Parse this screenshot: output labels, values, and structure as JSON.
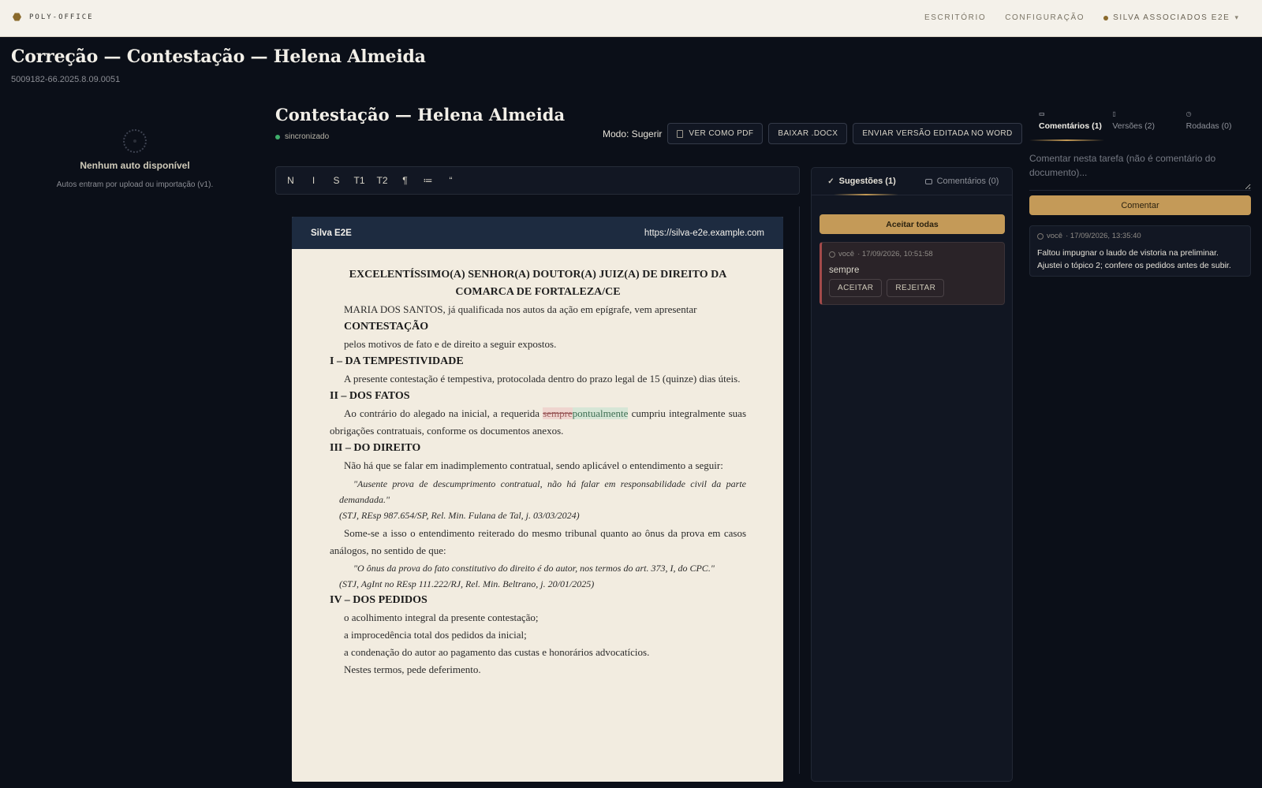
{
  "topbar": {
    "brand": "POLY-OFFICE",
    "nav": [
      "ESCRITÓRIO",
      "CONFIGURAÇÃO"
    ],
    "org": "SILVA ASSOCIADOS E2E",
    "org_chevron": "▾"
  },
  "page": {
    "title": "Correção — Contestação — Helena Almeida",
    "case_number": "5009182-66.2025.8.09.0051"
  },
  "autos": {
    "empty_title": "Nenhum auto disponível",
    "empty_sub": "Autos entram por upload ou importação (v1)."
  },
  "document": {
    "title": "Contestação — Helena Almeida",
    "sync_status": "sincronizado",
    "mode": "Modo: Sugerir",
    "buttons": {
      "pdf": "VER COMO PDF",
      "docx": "BAIXAR .DOCX",
      "word": "ENVIAR VERSÃO EDITADA NO WORD"
    },
    "toolbar": [
      "N",
      "I",
      "S",
      "T1",
      "T2",
      "¶",
      "≔",
      "“"
    ]
  },
  "paper": {
    "firm": "Silva E2E",
    "url": "https://silva-e2e.example.com",
    "address_line1": "EXCELENTÍSSIMO(A) SENHOR(A) DOUTOR(A) JUIZ(A) DE DIREITO DA",
    "address_line2": "COMARCA DE FORTALEZA/CE",
    "intro": "MARIA DOS SANTOS, já qualificada nos autos da ação em epígrafe, vem apresentar",
    "intro_title": "CONTESTAÇÃO",
    "intro_end": "pelos motivos de fato e de direito a seguir expostos.",
    "h1": "I – DA TEMPESTIVIDADE",
    "p1": "A presente contestação é tempestiva, protocolada dentro do prazo legal de 15 (quinze) dias úteis.",
    "h2": "II – DOS FATOS",
    "p2_before": "Ao contrário do alegado na inicial, a requerida ",
    "p2_deleted": "sempre",
    "p2_inserted": "pontualmente",
    "p2_after": " cumpriu integralmente suas obrigações contratuais, conforme os documentos anexos.",
    "h3": "III – DO DIREITO",
    "p3": "Não há que se falar em inadimplemento contratual, sendo aplicável o entendimento a seguir:",
    "q1": "\"Ausente prova de descumprimento contratual, não há falar em responsabilidade civil da parte demandada.\"",
    "q1_cite": "(STJ, REsp 987.654/SP, Rel. Min. Fulana de Tal, j. 03/03/2024)",
    "p4": "Some-se a isso o entendimento reiterado do mesmo tribunal quanto ao ônus da prova em casos análogos, no sentido de que:",
    "q2": "\"O ônus da prova do fato constitutivo do direito é do autor, nos termos do art. 373, I, do CPC.\"",
    "q2_cite": "(STJ, AgInt no REsp 111.222/RJ, Rel. Min. Beltrano, j. 20/01/2025)",
    "h4": "IV – DOS PEDIDOS",
    "req1": "o acolhimento integral da presente contestação;",
    "req2": "a improcedência total dos pedidos da inicial;",
    "req3": "a condenação do autor ao pagamento das custas e honorários advocatícios.",
    "closing": "Nestes termos, pede deferimento."
  },
  "suggestions": {
    "tab_suggestions": "Sugestões (1)",
    "tab_comments": "Comentários (0)",
    "accept_all": "Aceitar todas",
    "items": [
      {
        "author": "você",
        "timestamp": "· 17/09/2026, 10:51:58",
        "text": "sempre",
        "accept": "ACEITAR",
        "reject": "REJEITAR"
      }
    ]
  },
  "task_panel": {
    "tabs": [
      "Comentários (1)",
      "Versões (2)",
      "Rodadas (0)"
    ],
    "placeholder": "Comentar nesta tarefa (não é comentário do documento)...",
    "comment_button": "Comentar",
    "comments": [
      {
        "author": "você",
        "timestamp": "· 17/09/2026, 13:35:40",
        "text": "Faltou impugnar o laudo de vistoria na preliminar. Ajustei o tópico 2; confere os pedidos antes de subir."
      }
    ]
  },
  "colors": {
    "background": "#0b0f18",
    "accent": "#c49a58",
    "sync": "#3fae6b",
    "paper": "#f2ece0",
    "paper_header": "#1d2b40",
    "deleted": "#efd5cf",
    "inserted": "#d6e6d6"
  }
}
